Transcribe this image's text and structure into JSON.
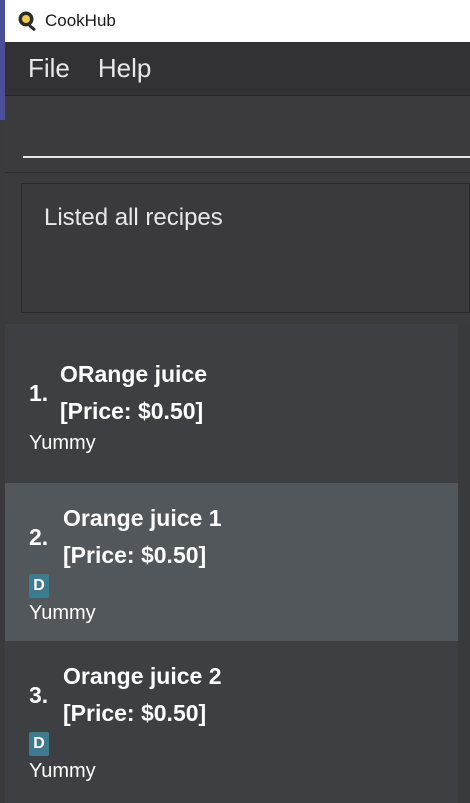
{
  "window": {
    "title": "CookHub"
  },
  "menu": {
    "file": "File",
    "help": "Help"
  },
  "command": {
    "value": "",
    "placeholder": ""
  },
  "result": {
    "text": "Listed all recipes"
  },
  "recipes": [
    {
      "index": "1.",
      "name": "ORange juice",
      "price": "[Price: $0.50]",
      "tags": [],
      "description": "Yummy"
    },
    {
      "index": "2.",
      "name": "Orange juice 1",
      "price": "[Price: $0.50]",
      "tags": [
        "D"
      ],
      "description": "Yummy"
    },
    {
      "index": "3.",
      "name": "Orange juice 2",
      "price": "[Price: $0.50]",
      "tags": [
        "D"
      ],
      "description": "Yummy"
    }
  ],
  "colors": {
    "selected_card": "#51575b",
    "tag": "#3e7b91",
    "menubar": "#323236"
  }
}
